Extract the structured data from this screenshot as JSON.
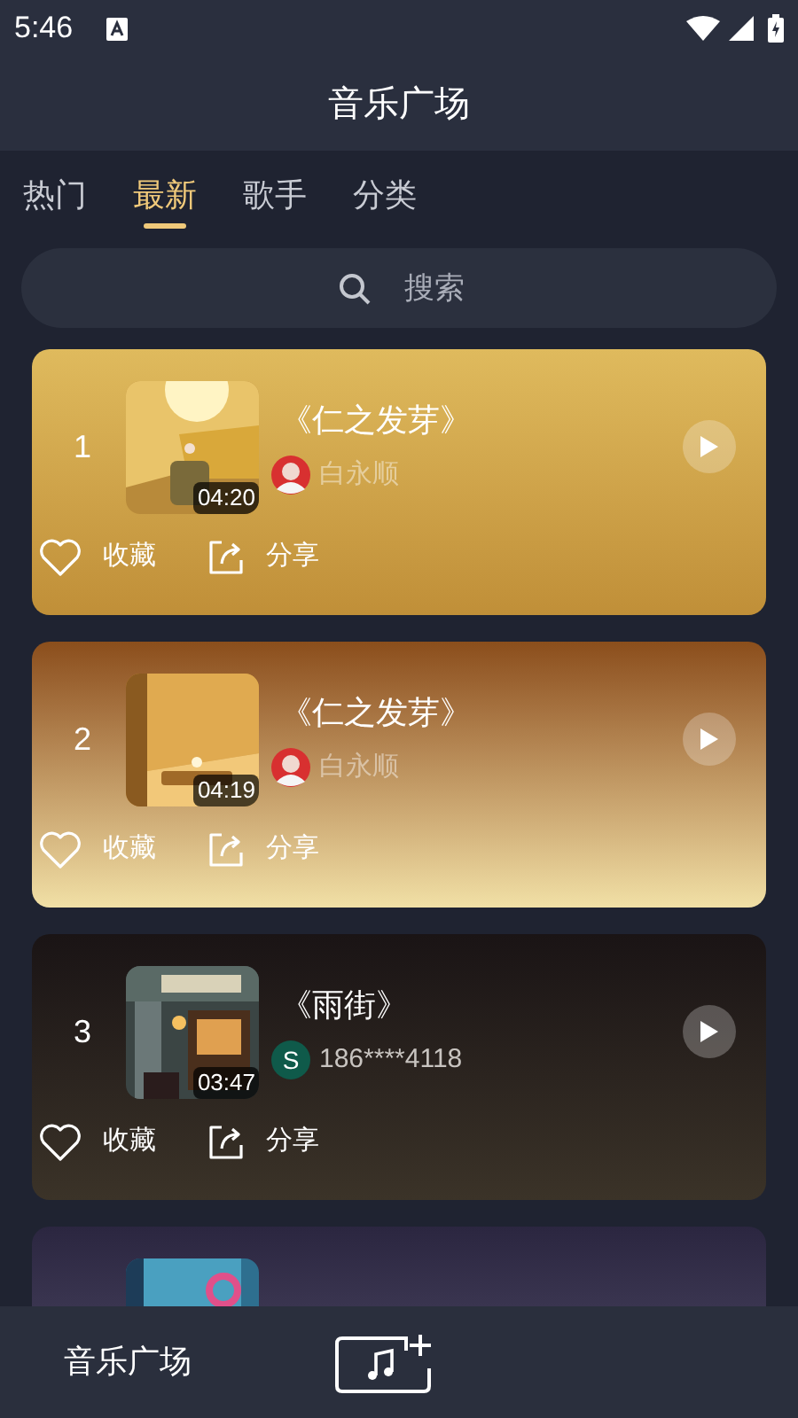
{
  "status_bar": {
    "time": "5:46"
  },
  "header": {
    "title": "音乐广场"
  },
  "tabs": [
    {
      "label": "热门",
      "selected": false
    },
    {
      "label": "最新",
      "selected": true
    },
    {
      "label": "歌手",
      "selected": false
    },
    {
      "label": "分类",
      "selected": false
    }
  ],
  "search": {
    "placeholder": "搜索"
  },
  "songs": [
    {
      "rank": "1",
      "title": "《仁之发芽》",
      "duration": "04:20",
      "author": "白永顺",
      "actions": [
        "收藏",
        "分享"
      ]
    },
    {
      "rank": "2",
      "title": "《仁之发芽》",
      "duration": "04:19",
      "author": "白永顺",
      "actions": [
        "收藏",
        "分享"
      ]
    },
    {
      "rank": "3",
      "title": "《雨街》",
      "duration": "03:47",
      "author": "186****4118",
      "avatar_letter": "S",
      "actions": [
        "收藏",
        "分享"
      ]
    },
    {
      "kind": "picture"
    }
  ],
  "bottom_nav": {
    "label": "音乐广场"
  }
}
